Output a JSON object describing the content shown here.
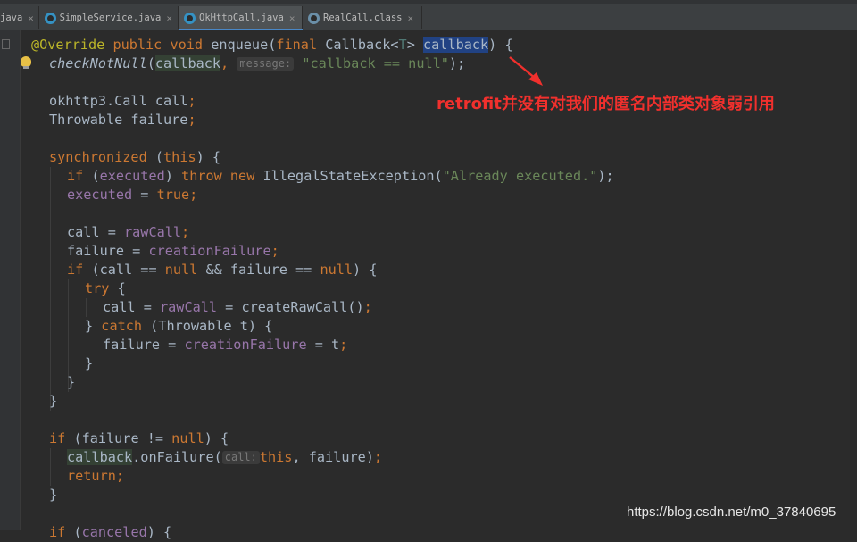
{
  "tabs": [
    {
      "label": "java",
      "active": false,
      "icon": "java-class-icon"
    },
    {
      "label": "SimpleService.java",
      "active": false,
      "icon": "java-class-icon"
    },
    {
      "label": "OkHttpCall.java",
      "active": true,
      "icon": "java-class-icon"
    },
    {
      "label": "RealCall.class",
      "active": false,
      "icon": "class-file-icon"
    }
  ],
  "tab_close_glyph": "×",
  "code": {
    "l1": {
      "ann": "@Override",
      "kw1": "public void",
      "name": "enqueue",
      "p1": "(",
      "kw2": "final",
      "type": "Callback<",
      "tp": "T",
      "gt": ">",
      "param": "callback",
      "end": ") {"
    },
    "l2": {
      "fn": "checkNotNull",
      "p1": "(",
      "arg": "callback",
      "comma": ",",
      "hint": "message:",
      "str": "\"callback == null\"",
      "end": ");"
    },
    "l3": {
      "text": "okhttp3.Call call",
      "semi": ";"
    },
    "l4": {
      "text": "Throwable failure",
      "semi": ";"
    },
    "l5": {
      "kw": "synchronized",
      "p1": " (",
      "kw2": "this",
      "end": ") {"
    },
    "l6": {
      "kw": "if",
      "p1": " (",
      "fld": "executed",
      "p2": ") ",
      "kw2": "throw new",
      "text": " IllegalStateException(",
      "str": "\"Already executed.\"",
      "end": ");"
    },
    "l7": {
      "fld": "executed",
      "eq": " = ",
      "kw": "true",
      "semi": ";"
    },
    "l8": {
      "text": "call = ",
      "fld": "rawCall",
      "semi": ";"
    },
    "l9": {
      "text": "failure = ",
      "fld": "creationFailure",
      "semi": ";"
    },
    "l10": {
      "kw": "if",
      "p1": " (call == ",
      "kw2": "null",
      "mid": " && failure == ",
      "kw3": "null",
      "end": ") {"
    },
    "l11": {
      "kw": "try",
      "end": " {"
    },
    "l12": {
      "text": "call = ",
      "fld": "rawCall",
      "rest": " = createRawCall()",
      "semi": ";"
    },
    "l13": {
      "p1": "} ",
      "kw": "catch",
      "rest": " (Throwable t) {"
    },
    "l14": {
      "text": "failure = ",
      "fld": "creationFailure",
      "rest": " = t",
      "semi": ";"
    },
    "l15": {
      "text": "}"
    },
    "l16": {
      "text": "}"
    },
    "l17": {
      "text": "}"
    },
    "l18": {
      "kw": "if",
      "p1": " (failure != ",
      "kw2": "null",
      "end": ") {"
    },
    "l19": {
      "var": "callback",
      "call": ".onFailure(",
      "hint": "call:",
      "kw": "this",
      "rest": ", failure)",
      "semi": ";"
    },
    "l20": {
      "kw": "return",
      "semi": ";"
    },
    "l21": {
      "text": "}"
    },
    "l22": {
      "kw": "if",
      "p1": " (",
      "fld": "canceled",
      "end": ") {"
    }
  },
  "annotation": {
    "text": "retrofit并没有对我们的匿名内部类对象弱引用",
    "color": "#f1302d"
  },
  "watermark": "https://blog.csdn.net/m0_37840695",
  "colors": {
    "background": "#2b2b2b",
    "keyword": "#cc7832",
    "string": "#6a8759",
    "field": "#9876aa",
    "annotation": "#bbb529",
    "selection": "#214283"
  }
}
